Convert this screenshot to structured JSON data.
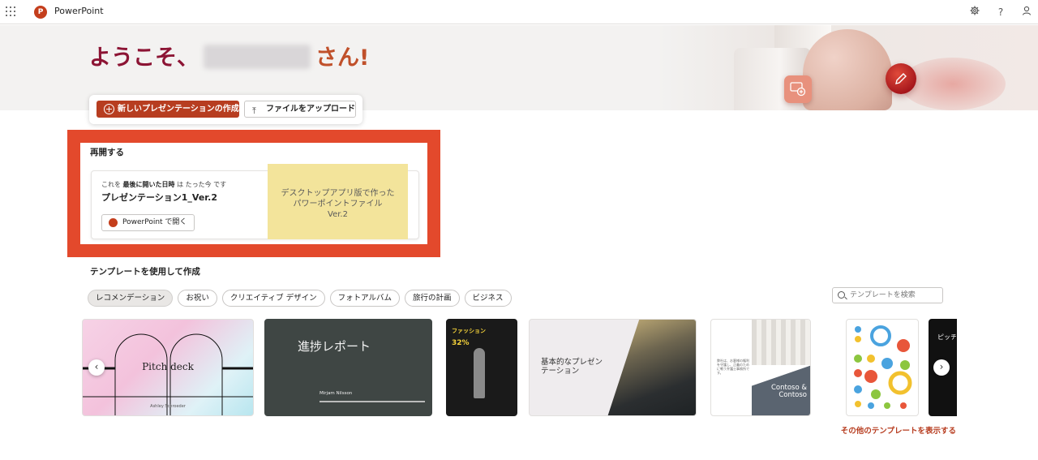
{
  "topbar": {
    "app_name": "PowerPoint",
    "logo_letter": "P",
    "icons": [
      "apps-launcher-icon",
      "gear-icon",
      "help-icon",
      "account-icon"
    ],
    "help_glyph": "?"
  },
  "hero": {
    "welcome_prefix": "ようこそ、",
    "welcome_suffix": "さん!",
    "actions": {
      "new_label": "新しいプレゼンテーションの作成",
      "upload_label": "ファイルをアップロード"
    }
  },
  "resume": {
    "title": "再開する",
    "item": {
      "meta_prefix": "これを",
      "meta_bold": "最後に開いた日時",
      "meta_suffix": "は たった今 です",
      "name": "プレゼンテーション1_Ver.2",
      "open_label": "PowerPoint で開く",
      "thumb_line1": "デスクトップアプリ版で作った",
      "thumb_line2": "パワーポイントファイル",
      "thumb_line3": "Ver.2"
    }
  },
  "templates": {
    "title": "テンプレートを使用して作成",
    "filters": [
      "レコメンデーション",
      "お祝い",
      "クリエイティブ デザイン",
      "フォトアルバム",
      "旅行の計画",
      "ビジネス"
    ],
    "active_filter": "レコメンデーション",
    "search_placeholder": "テンプレートを検索",
    "tiles": {
      "pitch_title": "Pitch deck",
      "pitch_sub": "Ashley Schroeder",
      "progress_title": "進捗レポート",
      "progress_sub": "Mirjam Nilsson",
      "fashion_title": "ファッション",
      "fashion_pct": "32%",
      "basic_title_line1": "基本的なプレゼン",
      "basic_title_line2": "テーション",
      "contoso_line1": "Contoso &",
      "contoso_line2": "Contoso",
      "contoso_text": "弊社は、お客様の権利を守護し、正義のために戦う弁護士事務所です。",
      "pitch2_title": "ピッチ デ"
    },
    "nav_prev": "‹",
    "nav_next": "›",
    "more_link": "その他のテンプレートを表示する"
  },
  "colors": {
    "brand": "#b73d20",
    "welcome": "#8c1434",
    "highlight": "#e3492c",
    "thumb_yellow": "#f3e49b"
  }
}
